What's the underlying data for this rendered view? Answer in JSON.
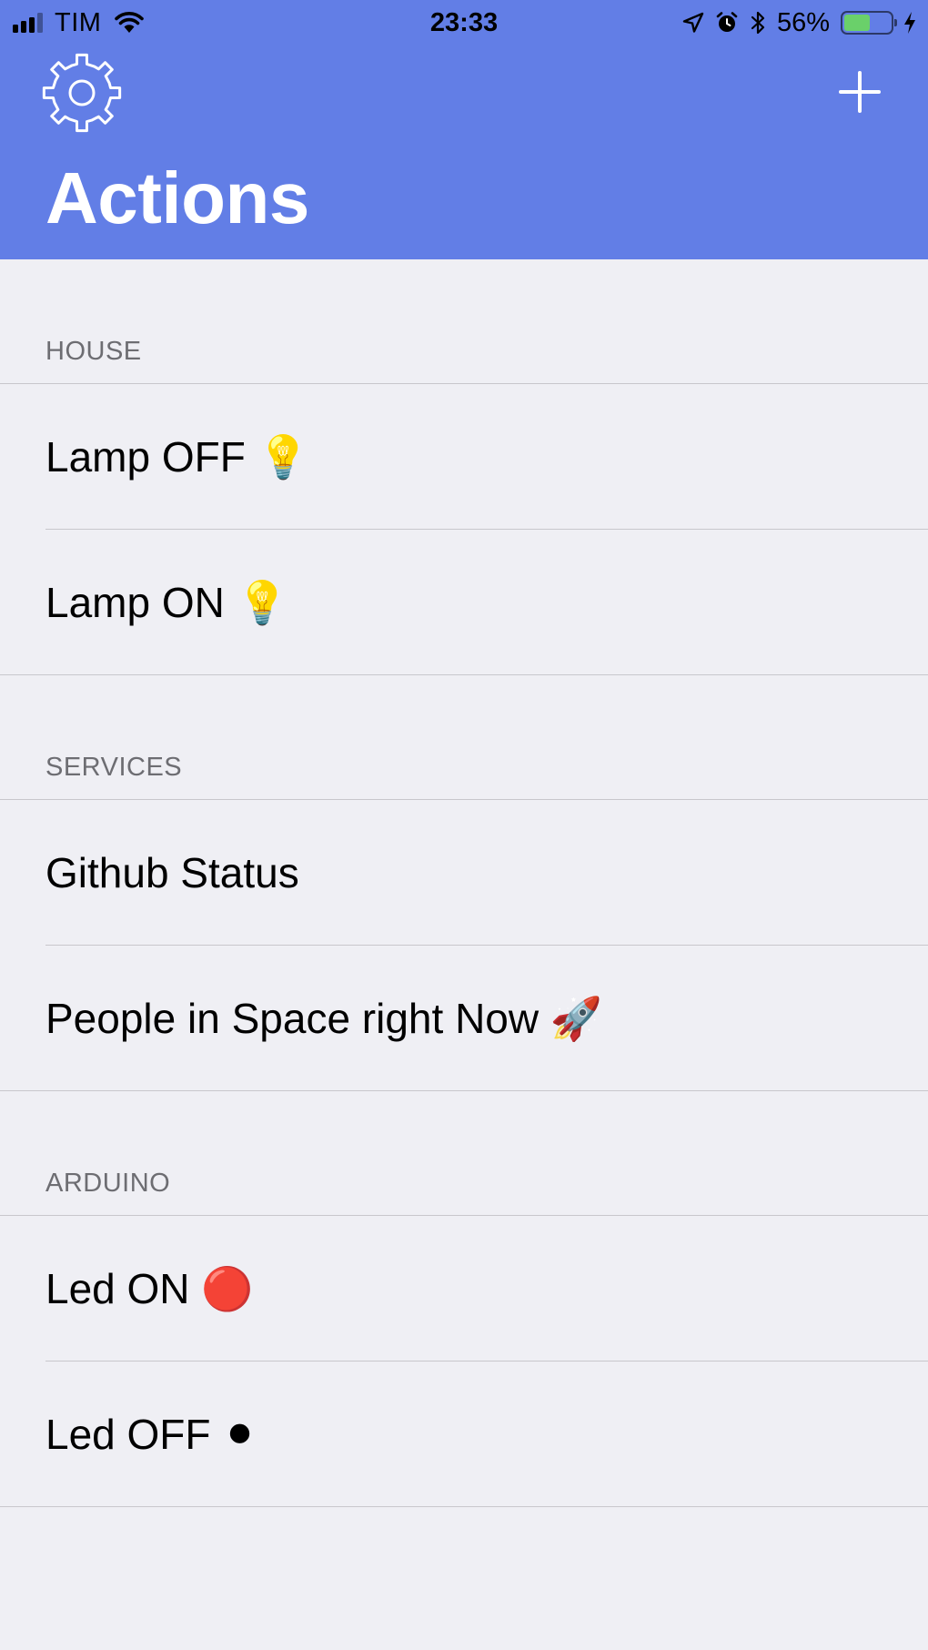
{
  "status_bar": {
    "carrier": "TIM",
    "time": "23:33",
    "battery_percent": "56%",
    "battery_level": 0.56,
    "signal_bars": 3,
    "icons": [
      "signal-icon",
      "wifi-icon",
      "location-arrow-icon",
      "alarm-icon",
      "bluetooth-icon",
      "battery-icon",
      "charging-bolt-icon"
    ]
  },
  "header": {
    "title": "Actions",
    "background_color": "#627ee6",
    "left_icon": "gear-icon",
    "right_icon": "plus-icon"
  },
  "sections": [
    {
      "title": "HOUSE",
      "items": [
        {
          "label": "Lamp OFF 💡"
        },
        {
          "label": "Lamp ON 💡"
        }
      ]
    },
    {
      "title": "SERVICES",
      "items": [
        {
          "label": "Github Status"
        },
        {
          "label": "People in Space right Now 🚀"
        }
      ]
    },
    {
      "title": "ARDUINO",
      "items": [
        {
          "label": "Led ON 🔴"
        },
        {
          "label": "Led OFF ⚫"
        }
      ]
    }
  ]
}
